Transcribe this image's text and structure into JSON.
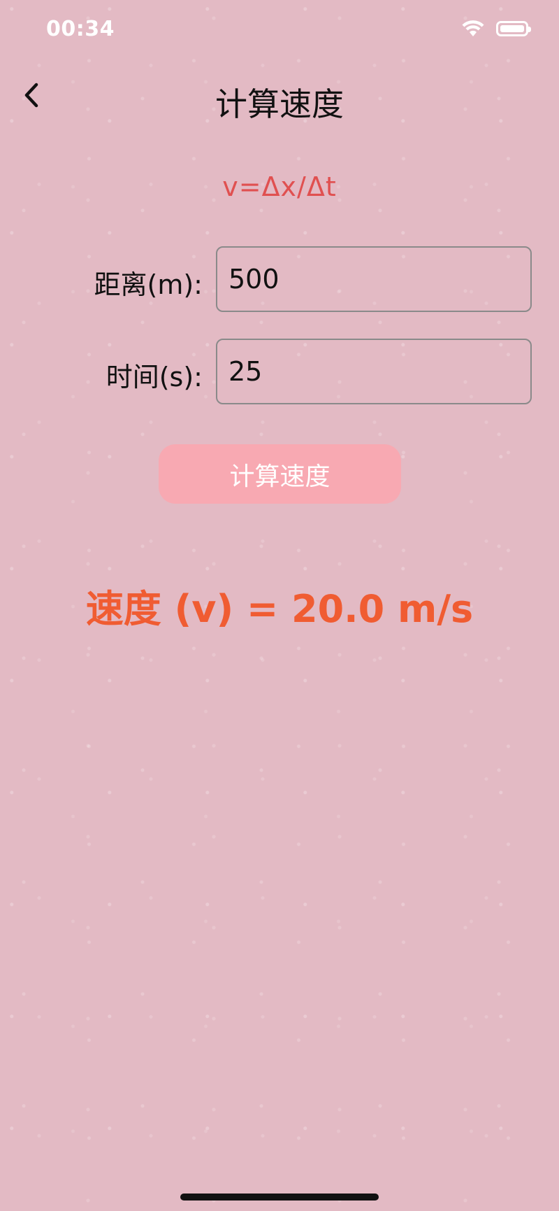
{
  "status_bar": {
    "time": "00:34",
    "icons": [
      "wifi-icon",
      "battery-icon"
    ]
  },
  "nav": {
    "title": "计算速度",
    "back_icon": "chevron-left-icon"
  },
  "formula": "v=Δx/Δt",
  "form": {
    "distance_label": "距离(m):",
    "distance_value": "500",
    "time_label": "时间(s):",
    "time_value": "25"
  },
  "button": {
    "calculate_label": "计算速度"
  },
  "result": "速度 (v) = 20.0 m/s",
  "colors": {
    "background": "#e3bac4",
    "formula": "#e05050",
    "button": "#f8a9b2",
    "result": "#f05c32"
  }
}
